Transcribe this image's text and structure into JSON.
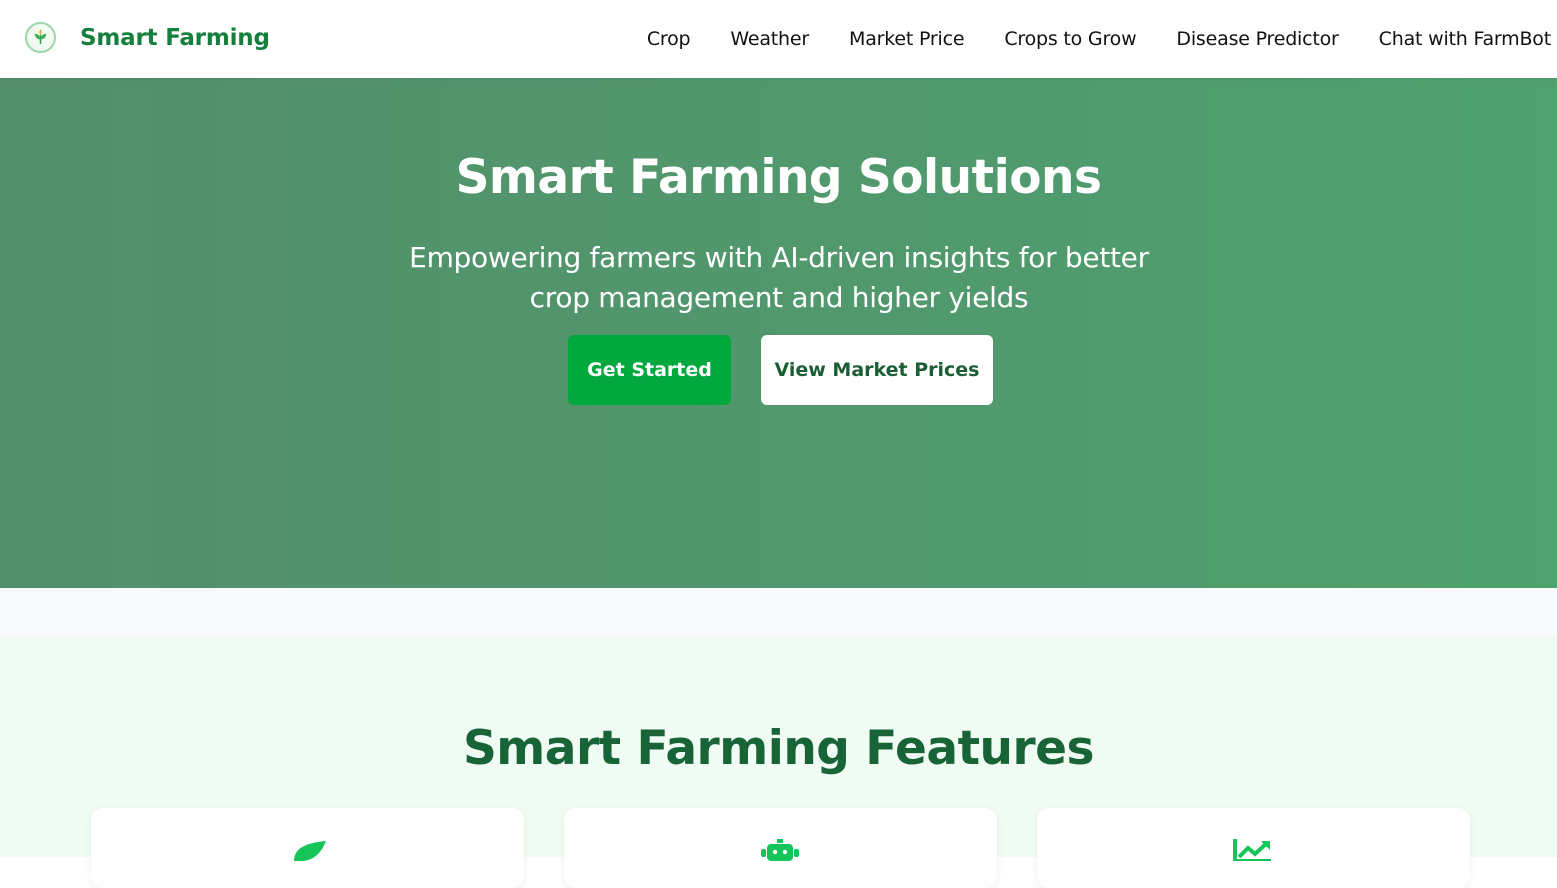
{
  "navbar": {
    "brand_name": "Smart Farming",
    "brand_icon": "sprout-leaf-icon",
    "links": [
      "Crop",
      "Weather",
      "Market Price",
      "Crops to Grow",
      "Disease Predictor",
      "Chat with FarmBot"
    ]
  },
  "hero": {
    "title": "Smart Farming Solutions",
    "subtitle": "Empowering farmers with AI-driven insights for better crop management and higher yields",
    "primary_button": "Get Started",
    "secondary_button": "View Market Prices"
  },
  "features": {
    "title": "Smart Farming Features",
    "cards": [
      {
        "icon": "leaf-icon"
      },
      {
        "icon": "robot-icon"
      },
      {
        "icon": "chart-trend-icon"
      }
    ]
  },
  "colors": {
    "brand_green": "#15803d",
    "hero_gradient_start": "#538e6b",
    "hero_gradient_end": "#4fa16f",
    "primary_button": "#00a83e",
    "features_bg": "#effbf3",
    "features_title": "#186437"
  }
}
